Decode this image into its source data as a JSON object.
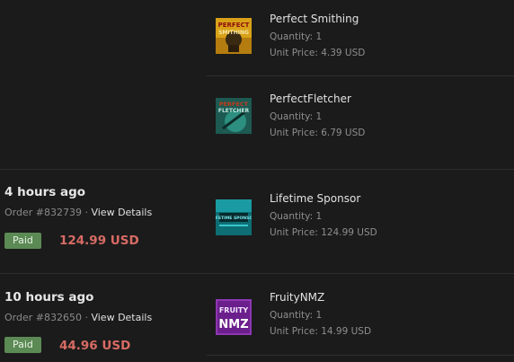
{
  "colors": {
    "background": "#1b1b1b",
    "paid_badge": "#5b8a54",
    "total_price": "#d86b64",
    "divider": "#2e2e2e"
  },
  "labels": {
    "quantity_prefix": "Quantity: ",
    "unit_price_prefix": "Unit Price: ",
    "order_prefix": "Order ",
    "separator": " · "
  },
  "orders": [
    {
      "items": [
        {
          "name": "Perfect Smithing",
          "quantity": "Quantity: 1",
          "unit_price": "Unit Price: 4.39 USD",
          "thumb_text": "PERFECT SMITHING",
          "thumb_icon": "perfect-smithing-thumbnail"
        },
        {
          "name": "PerfectFletcher",
          "quantity": "Quantity: 1",
          "unit_price": "Unit Price: 6.79 USD",
          "thumb_text": "PERFECT FLETCHER",
          "thumb_icon": "perfect-fletcher-thumbnail"
        }
      ]
    },
    {
      "time_ago": "4 hours ago",
      "order_number": "Order #832739",
      "view_details": "View Details",
      "status": "Paid",
      "total": "124.99 USD",
      "items": [
        {
          "name": "Lifetime Sponsor",
          "quantity": "Quantity: 1",
          "unit_price": "Unit Price: 124.99 USD",
          "thumb_text": "LIFETIME SPONSOR",
          "thumb_icon": "lifetime-sponsor-thumbnail"
        }
      ]
    },
    {
      "time_ago": "10 hours ago",
      "order_number": "Order #832650",
      "view_details": "View Details",
      "status": "Paid",
      "total": "44.96 USD",
      "items": [
        {
          "name": "FruityNMZ",
          "quantity": "Quantity: 1",
          "unit_price": "Unit Price: 14.99 USD",
          "thumb_text": "FRUITY NMZ",
          "thumb_icon": "fruity-nmz-thumbnail"
        }
      ]
    }
  ]
}
